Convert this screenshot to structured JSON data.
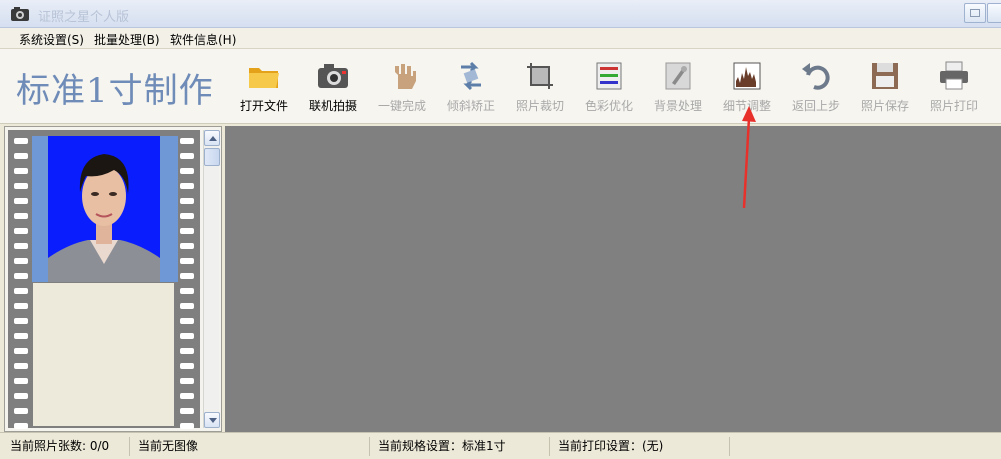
{
  "window": {
    "title": "证照之星个人版"
  },
  "menu": {
    "items": [
      {
        "label": "系统设置(S)"
      },
      {
        "label": "批量处理(B)"
      },
      {
        "label": "软件信息(H)"
      }
    ]
  },
  "header": {
    "app_title": "标准1寸制作"
  },
  "toolbar": {
    "tools": [
      {
        "label": "打开文件",
        "icon": "folder-icon",
        "enabled": true
      },
      {
        "label": "联机拍摄",
        "icon": "camera-icon",
        "enabled": true
      },
      {
        "label": "一键完成",
        "icon": "hand-icon",
        "enabled": false
      },
      {
        "label": "倾斜矫正",
        "icon": "rotate-icon",
        "enabled": false
      },
      {
        "label": "照片裁切",
        "icon": "crop-icon",
        "enabled": false
      },
      {
        "label": "色彩优化",
        "icon": "color-sliders-icon",
        "enabled": false
      },
      {
        "label": "背景处理",
        "icon": "brush-icon",
        "enabled": false
      },
      {
        "label": "细节调整",
        "icon": "histogram-icon",
        "enabled": false
      },
      {
        "label": "返回上步",
        "icon": "undo-icon",
        "enabled": false
      },
      {
        "label": "照片保存",
        "icon": "floppy-icon",
        "enabled": false
      },
      {
        "label": "照片打印",
        "icon": "printer-icon",
        "enabled": false
      }
    ]
  },
  "status": {
    "photo_count": "当前照片张数: 0/0",
    "image_state": "当前无图像",
    "spec": "当前规格设置：标准1寸",
    "print": "当前打印设置：(无)"
  },
  "colors": {
    "accent_title": "#6f8bb7",
    "photo_background": "#0a1dfc",
    "workspace": "#808080",
    "annotation_arrow": "#e8312b"
  }
}
